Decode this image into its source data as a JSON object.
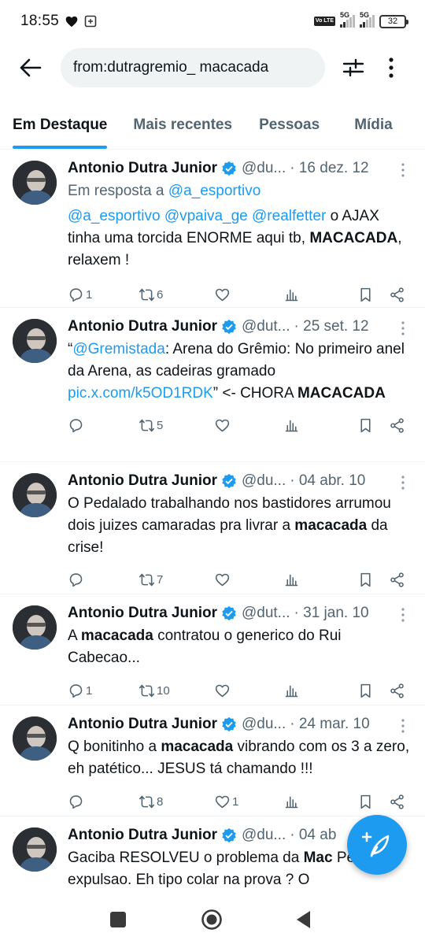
{
  "status": {
    "time": "18:55",
    "net1": "5G",
    "net2": "5G",
    "volte": "Vo LTE",
    "battery": "32"
  },
  "search": {
    "query": "from:dutragremio_ macacada"
  },
  "tabs": [
    {
      "label": "Em Destaque"
    },
    {
      "label": "Mais recentes"
    },
    {
      "label": "Pessoas"
    },
    {
      "label": "Mídia"
    }
  ],
  "tweets": [
    {
      "name": "Antonio Dutra Junior",
      "handle": "@du...",
      "date": "· 16 dez. 12",
      "reply_prefix": "Em resposta a ",
      "reply_to": "@a_esportivo",
      "m1": "@a_esportivo",
      "m2": "@vpaiva_ge",
      "m3": "@realfetter",
      "t1": " o AJAX tinha uma torcida ENORME aqui tb, ",
      "b1": "MACACADA",
      "t2": ", relaxem !",
      "replies": "1",
      "retweets": "6",
      "likes": ""
    },
    {
      "name": "Antonio Dutra Junior",
      "handle": "@dut...",
      "date": "· 25 set. 12",
      "q1": "“",
      "m1": "@Gremistada",
      "t1": ": Arena do Grêmio: No primeiro anel da Arena, as cadeiras gramado ",
      "link": "pic.x.com/k5OD1RDK",
      "t2": "” <- CHORA ",
      "b1": "MACACADA",
      "replies": "",
      "retweets": "5",
      "likes": ""
    },
    {
      "name": "Antonio Dutra Junior",
      "handle": "@du...",
      "date": "· 04 abr. 10",
      "t1": "O Pedalado trabalhando nos bastidores arrumou dois juizes camaradas pra livrar a ",
      "b1": "macacada",
      "t2": " da crise!",
      "replies": "",
      "retweets": "7",
      "likes": ""
    },
    {
      "name": "Antonio Dutra Junior",
      "handle": "@dut...",
      "date": "· 31 jan. 10",
      "t1": "A ",
      "b1": "macacada",
      "t2": " contratou o generico do Rui Cabecao...",
      "replies": "1",
      "retweets": "10",
      "likes": ""
    },
    {
      "name": "Antonio Dutra Junior",
      "handle": "@du...",
      "date": "· 24 mar. 10",
      "t1": "Q bonitinho a ",
      "b1": "macacada",
      "t2": " vibrando com os 3 a zero, eh patético... JESUS tá chamando !!!",
      "replies": "",
      "retweets": "8",
      "likes": "1"
    },
    {
      "name": "Antonio Dutra Junior",
      "handle": "@du...",
      "date": "· 04 ab",
      "t1": "Gaciba RESOLVEU o problema da ",
      "b1": "Mac",
      "t2": " Penalti e expulsao. Eh tipo colar na prova ? O"
    }
  ],
  "colors": {
    "accent": "#1d9bf0",
    "text": "#0f1419",
    "muted": "#536471"
  },
  "icons": [
    "back-arrow-icon",
    "filter-icon",
    "more-vertical-icon",
    "verified-badge-icon",
    "reply-icon",
    "retweet-icon",
    "like-icon",
    "views-icon",
    "bookmark-icon",
    "share-icon",
    "compose-icon"
  ]
}
